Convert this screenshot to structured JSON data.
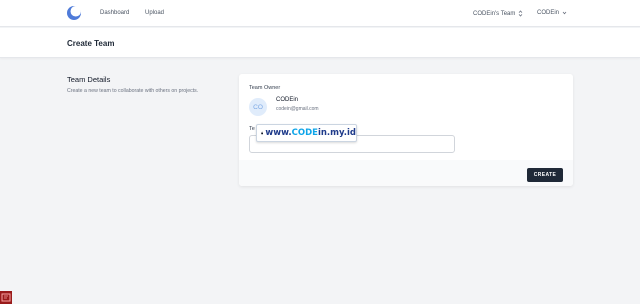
{
  "navbar": {
    "logo_icon": "planet-logo-icon",
    "links": {
      "dashboard": "Dashboard",
      "upload": "Upload"
    },
    "team_switcher_label": "CODEin's Team",
    "user_menu_label": "CODEin"
  },
  "header": {
    "title": "Create Team"
  },
  "section": {
    "title": "Team Details",
    "description": "Create a new team to collaborate with others on projects."
  },
  "form": {
    "owner_label": "Team Owner",
    "owner_initials": "CO",
    "owner_name": "CODEin",
    "owner_email": "codein@gmail.com",
    "team_name_label": "Te",
    "team_name_value": "",
    "create_label": "CREATE"
  },
  "watermark": {
    "prefix": "www.",
    "highlight": "CODE",
    "suffix": "in.my.id"
  },
  "colors": {
    "accent": "#1f2937",
    "avatar_bg": "#e0ecfb",
    "background": "#f3f4f6"
  }
}
